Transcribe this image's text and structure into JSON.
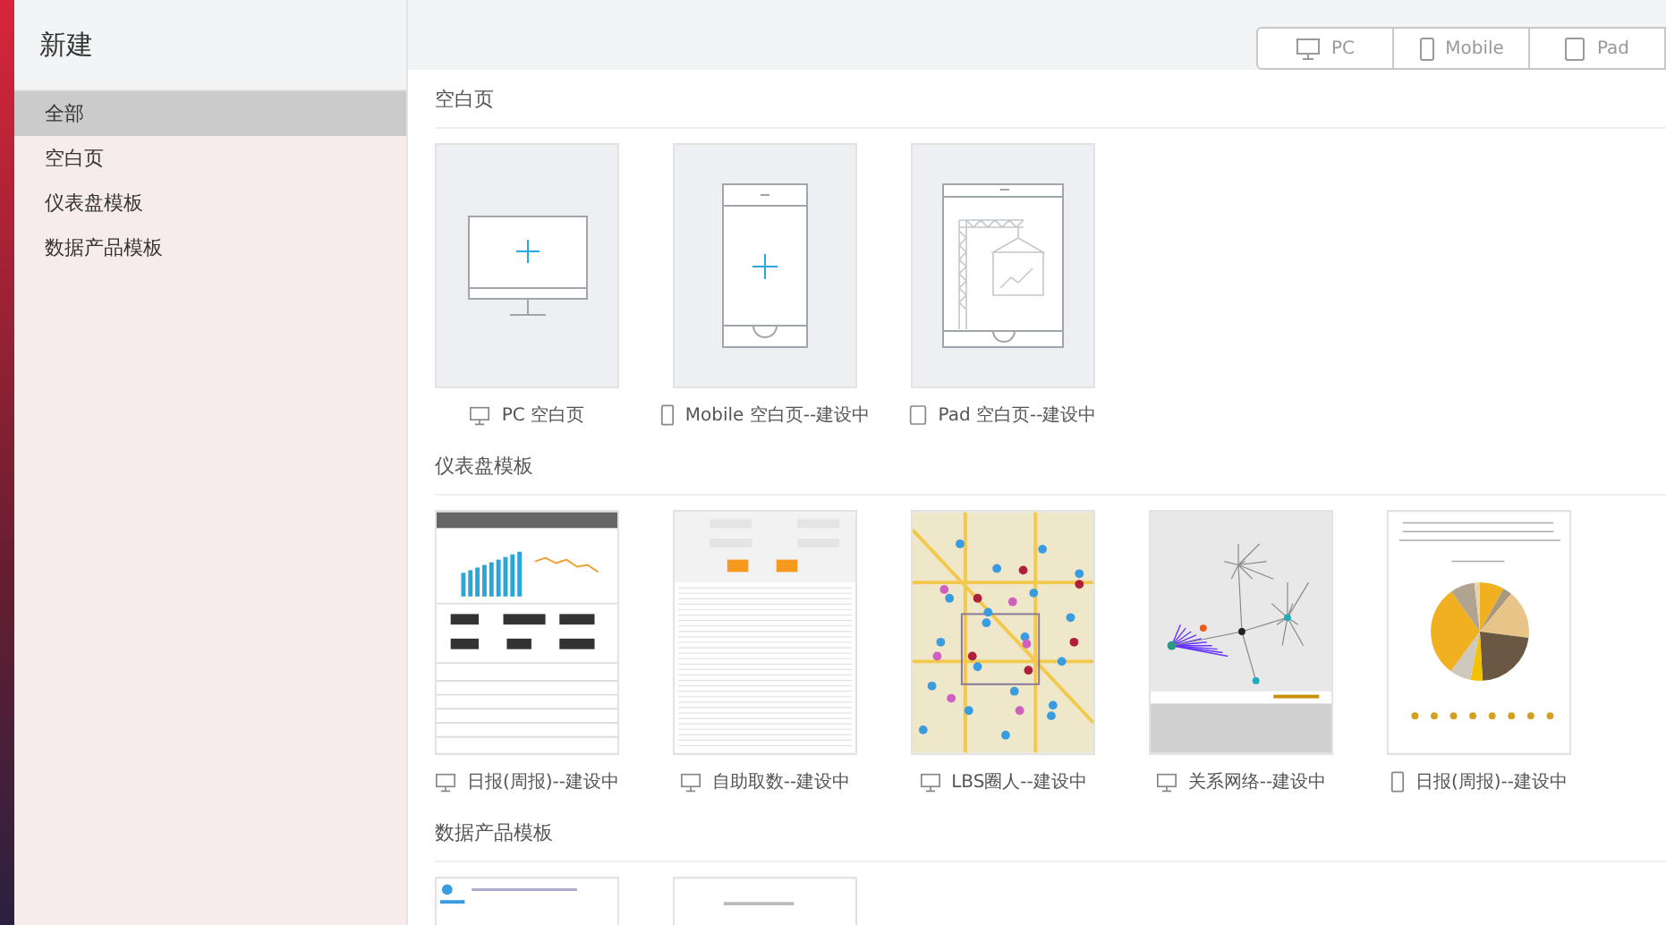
{
  "sidebar": {
    "title": "新建",
    "items": [
      {
        "label": "全部",
        "selected": true
      },
      {
        "label": "空白页",
        "selected": false
      },
      {
        "label": "仪表盘模板",
        "selected": false
      },
      {
        "label": "数据产品模板",
        "selected": false
      }
    ]
  },
  "device_tabs": [
    {
      "label": "PC",
      "kind": "pc",
      "selected": false
    },
    {
      "label": "Mobile",
      "kind": "mobile",
      "selected": false
    },
    {
      "label": "Pad",
      "kind": "pad",
      "selected": false
    }
  ],
  "sections": [
    {
      "title": "空白页",
      "cards": [
        {
          "label": "PC 空白页",
          "kind": "blankpc",
          "icon": {
            "kind": "pc"
          }
        },
        {
          "label": "Mobile 空白页--建设中",
          "kind": "blankmobile",
          "icon": {
            "kind": "mobile"
          }
        },
        {
          "label": "Pad 空白页--建设中",
          "kind": "blankpad",
          "icon": {
            "kind": "pad"
          }
        }
      ]
    },
    {
      "title": "仪表盘模板",
      "cards": [
        {
          "label": "日报(周报)--建设中",
          "kind": "report",
          "icon": {
            "kind": "pc"
          }
        },
        {
          "label": "自助取数--建设中",
          "kind": "table",
          "icon": {
            "kind": "pc"
          }
        },
        {
          "label": "LBS圈人--建设中",
          "kind": "map",
          "icon": {
            "kind": "pc"
          }
        },
        {
          "label": "关系网络--建设中",
          "kind": "network",
          "icon": {
            "kind": "pc"
          }
        },
        {
          "label": "日报(周报)--建设中",
          "kind": "pie",
          "icon": {
            "kind": "mobile"
          }
        }
      ]
    },
    {
      "title": "数据产品模板",
      "cards": [
        {
          "kind": "app"
        },
        {
          "kind": "doc"
        }
      ]
    }
  ]
}
